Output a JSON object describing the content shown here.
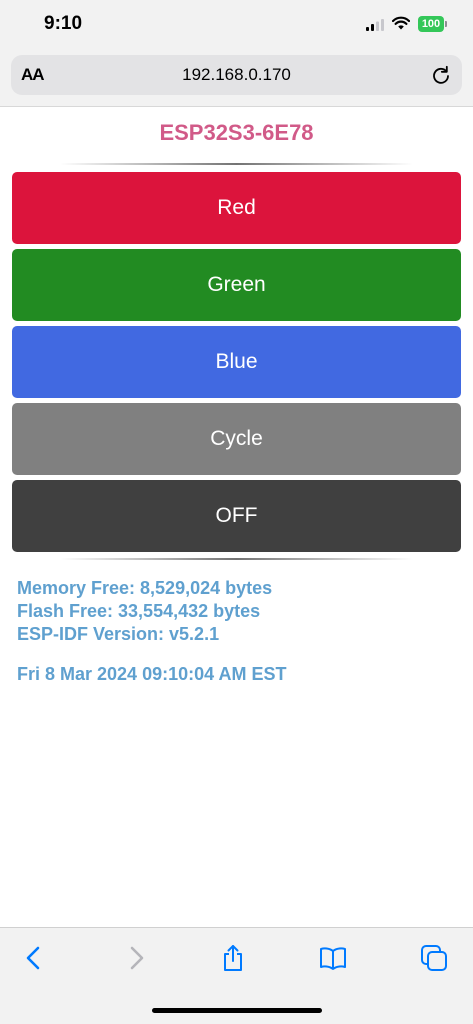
{
  "status_bar": {
    "time": "9:10",
    "battery": "100"
  },
  "browser": {
    "text_size_label": "AA",
    "url": "192.168.0.170"
  },
  "page": {
    "title": "ESP32S3-6E78",
    "buttons": [
      {
        "label": "Red",
        "color": "#dc143c"
      },
      {
        "label": "Green",
        "color": "#228b22"
      },
      {
        "label": "Blue",
        "color": "#4169e1"
      },
      {
        "label": "Cycle",
        "color": "#808080"
      },
      {
        "label": "OFF",
        "color": "#404040"
      }
    ],
    "info": {
      "memory_free": "Memory Free: 8,529,024 bytes",
      "flash_free": "Flash Free: 33,554,432 bytes",
      "idf_version": "ESP-IDF Version: v5.2.1",
      "datetime": "Fri 8 Mar 2024 09:10:04 AM EST"
    }
  },
  "colors": {
    "title": "#d15a88",
    "info_text": "#5fa0cf",
    "ios_blue": "#007aff",
    "battery_green": "#34c759"
  },
  "toolbar": {
    "icons": [
      "back-icon",
      "forward-icon",
      "share-icon",
      "bookmarks-icon",
      "tabs-icon"
    ]
  }
}
